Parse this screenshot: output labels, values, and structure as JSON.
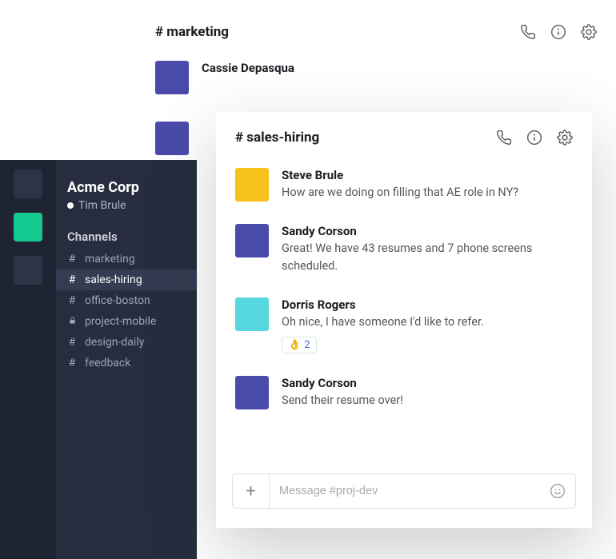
{
  "colors": {
    "purple": "#4a4aaa",
    "yellow": "#f7c21a",
    "cyan": "#57d7df"
  },
  "backWindow": {
    "channel": "# marketing",
    "messages": [
      {
        "user": "Cassie Depasqua",
        "avatarColor": "purple"
      }
    ]
  },
  "workspace": {
    "name": "Acme Corp",
    "user": "Tim Brule"
  },
  "sidebar": {
    "label": "Channels",
    "items": [
      {
        "name": "marketing",
        "private": false,
        "active": false
      },
      {
        "name": "sales-hiring",
        "private": false,
        "active": true
      },
      {
        "name": "office-boston",
        "private": false,
        "active": false
      },
      {
        "name": "project-mobile",
        "private": true,
        "active": false
      },
      {
        "name": "design-daily",
        "private": false,
        "active": false
      },
      {
        "name": "feedback",
        "private": false,
        "active": false
      }
    ]
  },
  "frontWindow": {
    "channel": "# sales-hiring",
    "messages": [
      {
        "user": "Steve Brule",
        "text": "How are we doing on filling that AE role in NY?",
        "avatarColor": "yellow"
      },
      {
        "user": "Sandy Corson",
        "text": "Great! We have 43 resumes and 7 phone screens scheduled.",
        "avatarColor": "purple"
      },
      {
        "user": "Dorris Rogers",
        "text": "Oh nice, I have someone I'd like to refer.",
        "avatarColor": "cyan",
        "reaction": {
          "emoji": "👌",
          "count": 2
        }
      },
      {
        "user": "Sandy Corson",
        "text": "Send their resume over!",
        "avatarColor": "purple"
      }
    ],
    "composerPlaceholder": "Message #proj-dev"
  }
}
